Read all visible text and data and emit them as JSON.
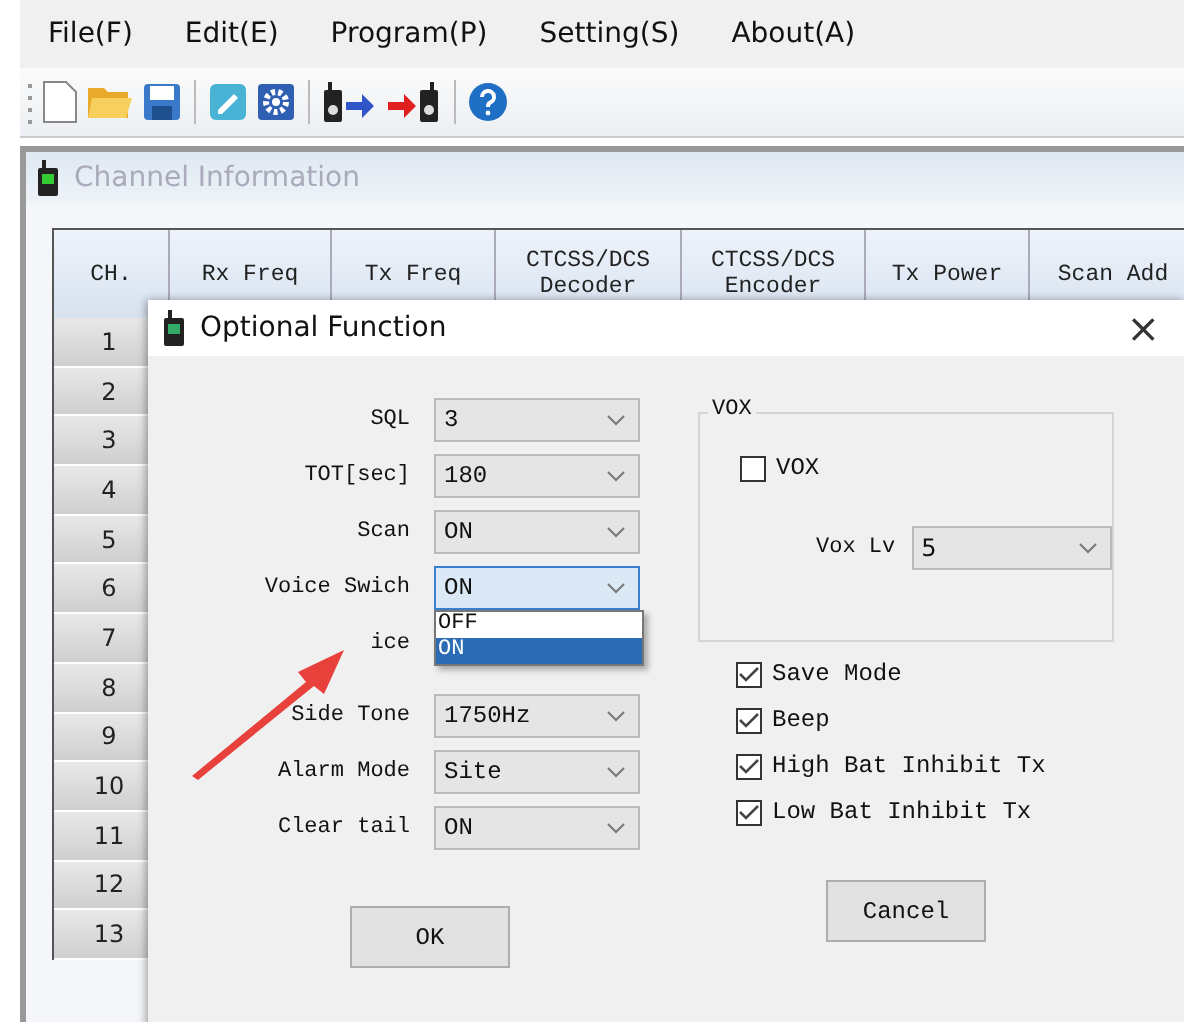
{
  "menu": [
    "File(F)",
    "Edit(E)",
    "Program(P)",
    "Setting(S)",
    "About(A)"
  ],
  "channel_window": {
    "title": "Channel Information",
    "columns": [
      "CH.",
      "Rx Freq",
      "Tx Freq",
      "CTCSS/DCS\nDecoder",
      "CTCSS/DCS\nEncoder",
      "Tx Power",
      "Scan Add"
    ],
    "rows": [
      "1",
      "2",
      "3",
      "4",
      "5",
      "6",
      "7",
      "8",
      "9",
      "10",
      "11",
      "12",
      "13"
    ]
  },
  "dialog": {
    "title": "Optional Function",
    "close": "×",
    "fields": [
      {
        "label": "SQL",
        "value": "3",
        "expanded": false
      },
      {
        "label": "TOT[sec]",
        "value": "180",
        "expanded": false
      },
      {
        "label": "Scan",
        "value": "ON",
        "expanded": false
      },
      {
        "label": "Voice Swich",
        "value": "ON",
        "expanded": true,
        "options": [
          {
            "label": "OFF",
            "selected": false
          },
          {
            "label": "ON",
            "selected": true
          }
        ]
      },
      {
        "label": "ice"
      },
      {
        "label": "Side Tone",
        "value": "1750Hz",
        "expanded": false
      },
      {
        "label": "Alarm Mode",
        "value": "Site",
        "expanded": false
      },
      {
        "label": "Clear tail",
        "value": "ON",
        "expanded": false
      }
    ],
    "vox": {
      "title": "VOX",
      "checkbox": {
        "label": "VOX",
        "checked": false
      },
      "level_label": "Vox Lv",
      "level_value": "5"
    },
    "checkboxes": [
      {
        "label": "Save Mode",
        "checked": true
      },
      {
        "label": "Beep",
        "checked": true
      },
      {
        "label": "High Bat Inhibit Tx",
        "checked": true
      },
      {
        "label": "Low Bat Inhibit Tx",
        "checked": true
      }
    ],
    "buttons": [
      "OK",
      "Cancel"
    ]
  }
}
